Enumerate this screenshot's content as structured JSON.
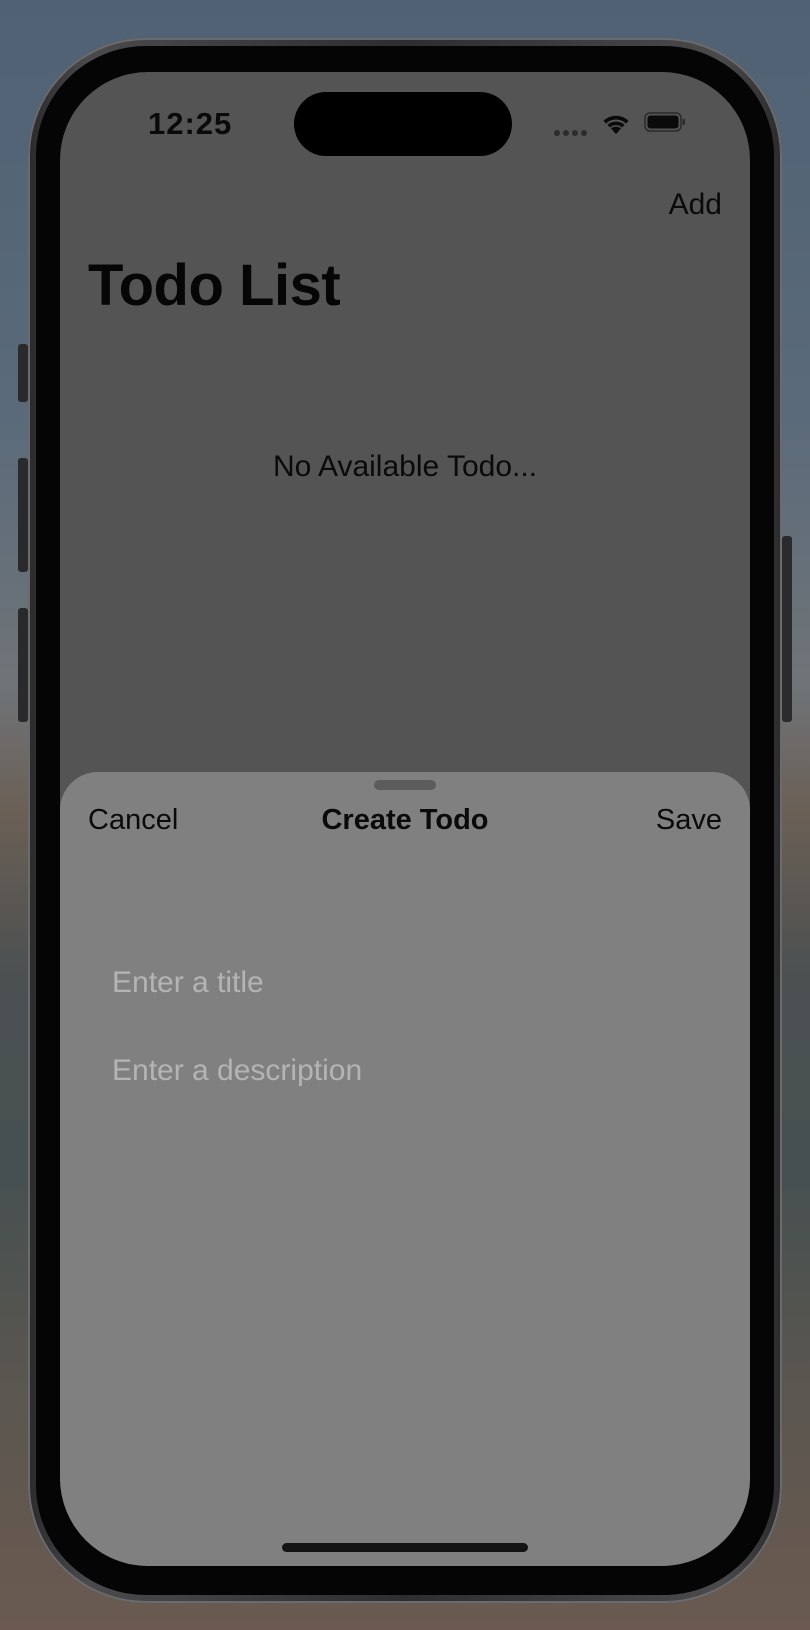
{
  "status_bar": {
    "time": "12:25",
    "icons": [
      "cellular-signal-icon",
      "wifi-icon",
      "battery-icon"
    ]
  },
  "nav": {
    "add_label": "Add",
    "title": "Todo List"
  },
  "list": {
    "empty_message": "No Available Todo..."
  },
  "sheet": {
    "cancel_label": "Cancel",
    "title": "Create Todo",
    "save_label": "Save",
    "title_placeholder": "Enter a title",
    "description_placeholder": "Enter a description"
  },
  "colors": {
    "dimmed_background": "#545454",
    "sheet_background": "#808080",
    "placeholder_text": "#b4b4b4",
    "primary_text": "#0a0a0a"
  }
}
